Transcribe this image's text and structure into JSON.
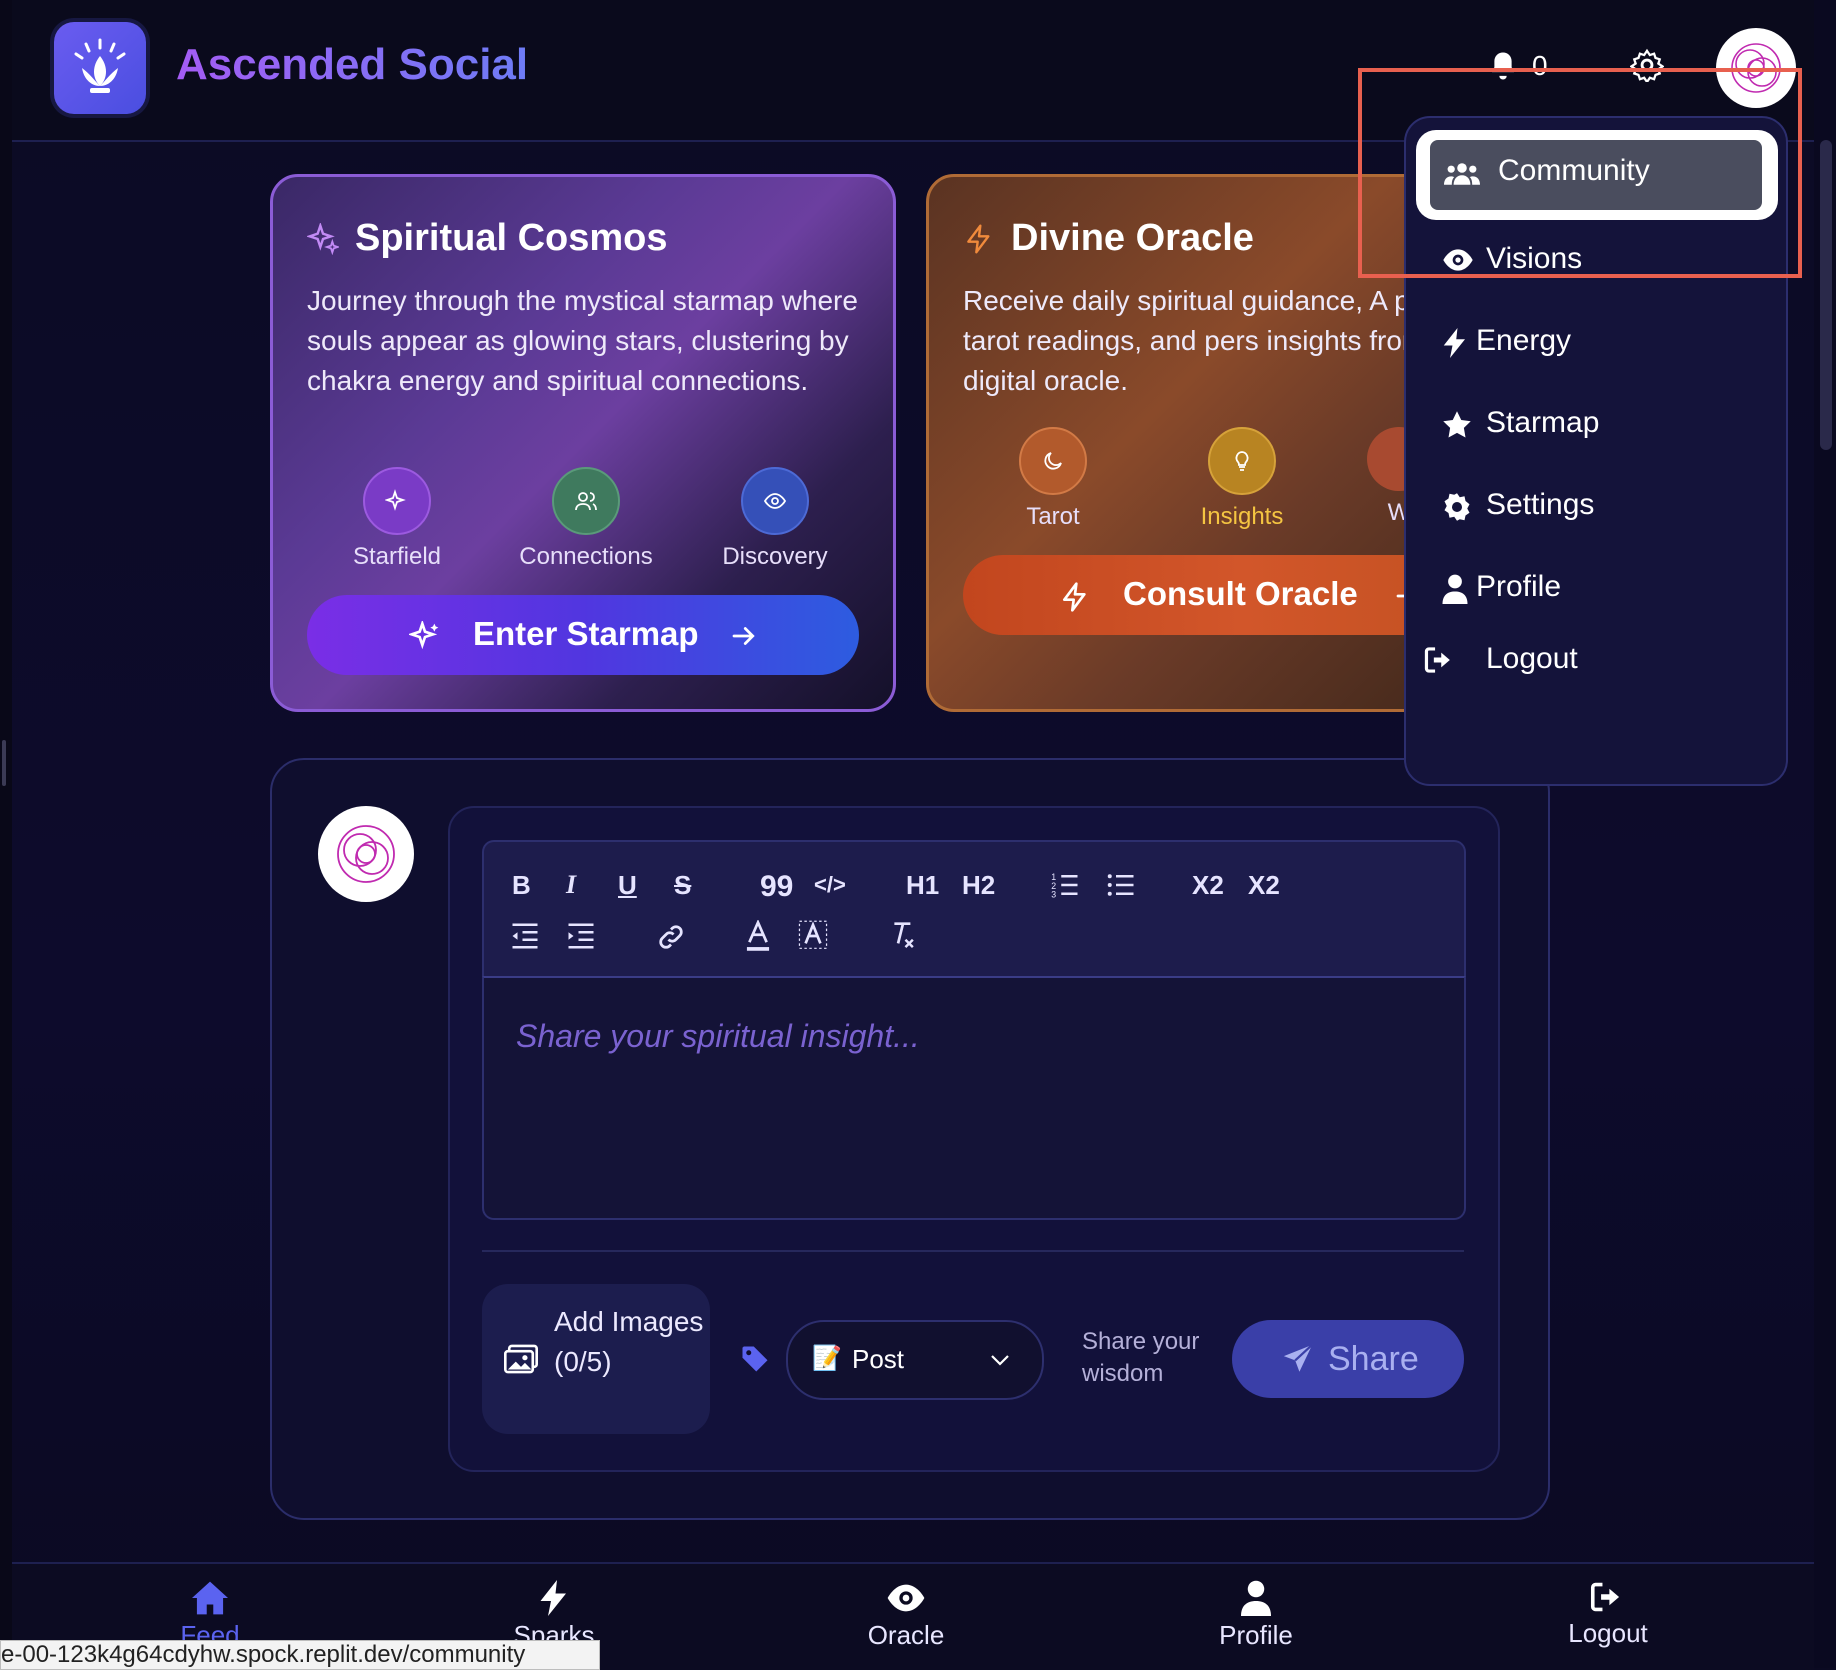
{
  "app": {
    "name": "Ascended Social"
  },
  "header": {
    "notification_count": "0"
  },
  "cards": {
    "cosmos": {
      "title": "Spiritual Cosmos",
      "description": "Journey through the mystical starmap where souls appear as glowing stars, clustering by chakra energy and spiritual connections.",
      "features": [
        "Starfield",
        "Connections",
        "Discovery"
      ],
      "cta": "Enter Starmap"
    },
    "oracle": {
      "title": "Divine Oracle",
      "description": "Receive daily spiritual guidance, A powered tarot readings, and pers insights from the digital oracle.",
      "features": [
        "Tarot",
        "Insights",
        "W"
      ],
      "cta": "Consult Oracle"
    }
  },
  "composer": {
    "toolbar": {
      "bold": "B",
      "italic": "I",
      "underline": "U",
      "strike": "S",
      "quote": "99",
      "code": "</>",
      "h1": "H1",
      "h2": "H2",
      "subscript": "X2",
      "superscript": "X2"
    },
    "placeholder": "Share your spiritual insight...",
    "add_images": "Add Images (0/5)",
    "post_type": {
      "emoji": "📝",
      "value": "Post"
    },
    "hint": "Share your wisdom",
    "share": "Share"
  },
  "menu": {
    "items": [
      "Community",
      "Visions",
      "Energy",
      "Starmap",
      "Settings",
      "Profile",
      "Logout"
    ],
    "active": "Community"
  },
  "bottom_nav": {
    "items": [
      "Feed",
      "Sparks",
      "Oracle",
      "Profile",
      "Logout"
    ],
    "active": "Feed"
  },
  "status_url": "e-00-123k4g64cdyhw.spock.replit.dev/community",
  "colors": {
    "accent": "#5b63f0",
    "highlight": "#e8604f",
    "cosmos_border": "#8b5cd6",
    "oracle_border": "#b06b36"
  }
}
